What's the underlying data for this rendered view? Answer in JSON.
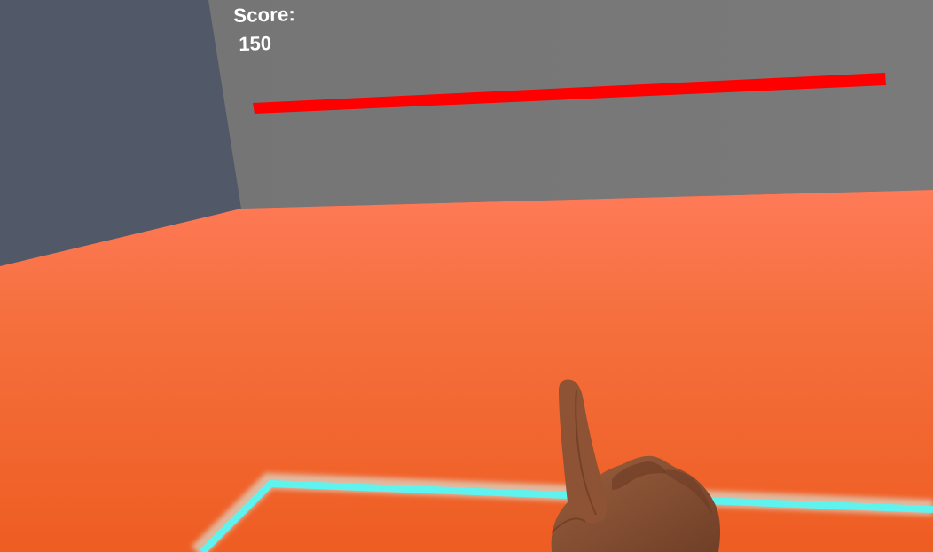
{
  "hud": {
    "score_label": "Score:",
    "score_value": "150"
  },
  "colors": {
    "floor": "#f0622a",
    "wall_back": "#767676",
    "wall_side": "#515867",
    "health_bar": "#ff0000",
    "boundary_outline": "#5ff3ef",
    "hand_skin": "#8a5236"
  },
  "icons": {
    "hand": "pointing-hand"
  }
}
